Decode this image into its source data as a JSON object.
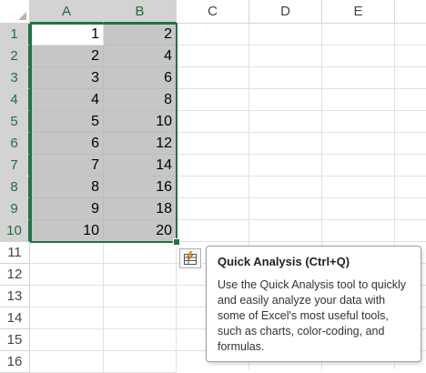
{
  "columns": [
    "A",
    "B",
    "C",
    "D",
    "E"
  ],
  "rows": [
    "1",
    "2",
    "3",
    "4",
    "5",
    "6",
    "7",
    "8",
    "9",
    "10",
    "11",
    "12",
    "13",
    "14",
    "15",
    "16"
  ],
  "cells": {
    "A": [
      "1",
      "2",
      "3",
      "4",
      "5",
      "6",
      "7",
      "8",
      "9",
      "10"
    ],
    "B": [
      "2",
      "4",
      "6",
      "8",
      "10",
      "12",
      "14",
      "16",
      "18",
      "20"
    ]
  },
  "selection": {
    "range": "A1:B10",
    "active_cell": "A1"
  },
  "quick_analysis": {
    "icon": "quick-analysis-icon",
    "tooltip_title": "Quick Analysis (Ctrl+Q)",
    "tooltip_body": "Use the Quick Analysis tool to quickly and easily analyze your data with some of Excel's most useful tools, such as charts, color-coding, and formulas."
  },
  "colors": {
    "accent": "#217346",
    "selection_fill": "#c6c6c6",
    "header_selected": "#d3d3d3"
  }
}
